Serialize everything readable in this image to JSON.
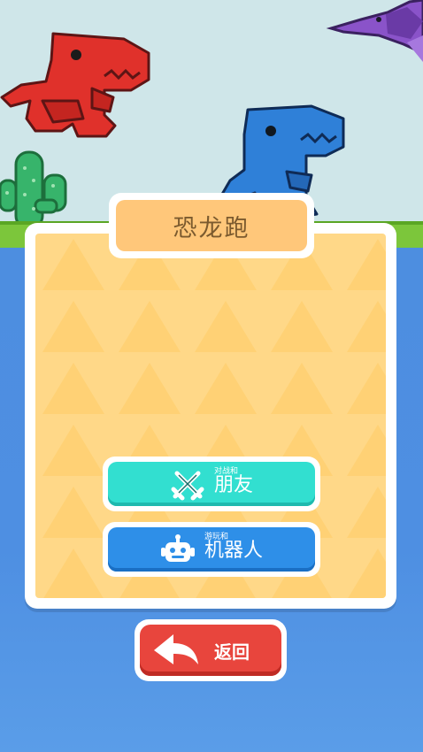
{
  "title": "恐龙跑",
  "buttons": {
    "friend": {
      "small": "对战和",
      "label": "朋友",
      "icon": "crossed-swords-icon"
    },
    "robot": {
      "small": "游玩和",
      "label": "机器人",
      "icon": "robot-icon"
    },
    "back": {
      "label": "返回",
      "icon": "back-arrow-icon"
    }
  },
  "colors": {
    "sky": "#cfe6e9",
    "grass": "#7cc63b",
    "water": "#4d8ee0",
    "panel": "#ffd888",
    "title_tab": "#ffc77a",
    "friend_button": "#32dfd0",
    "robot_button": "#2e8fe8",
    "back_button": "#e8453d",
    "red_dino": "#e0312b",
    "blue_dino": "#2f80d8",
    "purple_ptero": "#8a53c9"
  }
}
